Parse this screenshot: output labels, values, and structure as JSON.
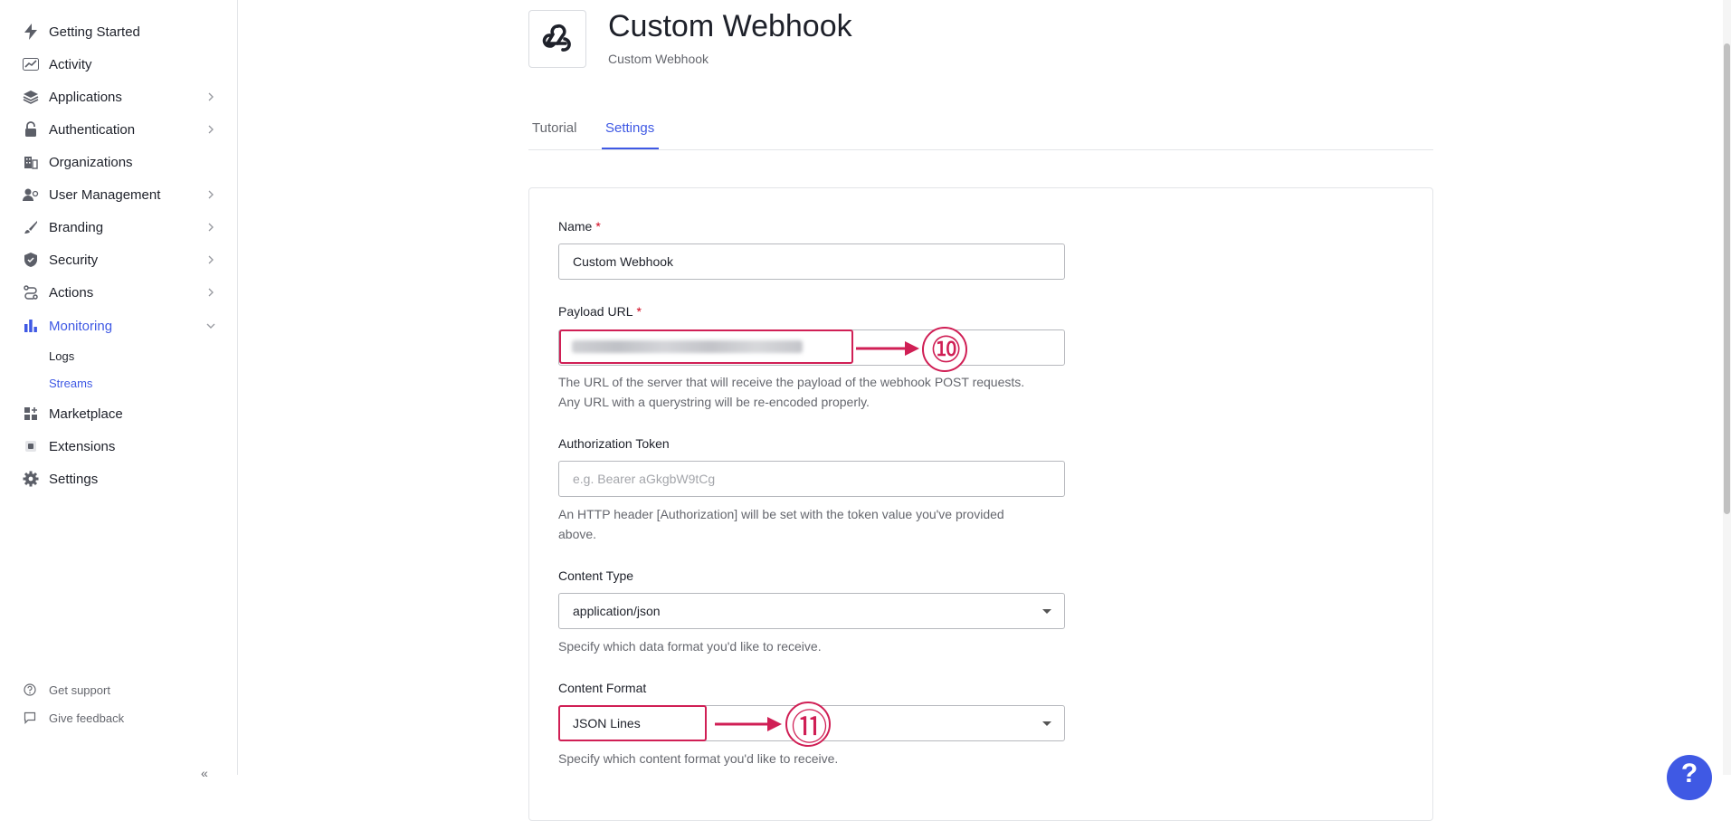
{
  "sidebar": {
    "items": [
      {
        "label": "Getting Started",
        "icon": "lightning-icon",
        "chevron": false
      },
      {
        "label": "Activity",
        "icon": "activity-chart-icon",
        "chevron": false
      },
      {
        "label": "Applications",
        "icon": "layers-icon",
        "chevron": true
      },
      {
        "label": "Authentication",
        "icon": "lock-icon",
        "chevron": true
      },
      {
        "label": "Organizations",
        "icon": "building-icon",
        "chevron": false
      },
      {
        "label": "User Management",
        "icon": "users-icon",
        "chevron": true
      },
      {
        "label": "Branding",
        "icon": "brush-icon",
        "chevron": true
      },
      {
        "label": "Security",
        "icon": "shield-icon",
        "chevron": true
      },
      {
        "label": "Actions",
        "icon": "flow-icon",
        "chevron": true
      },
      {
        "label": "Monitoring",
        "icon": "bar-chart-icon",
        "chevron": true,
        "expanded": true
      },
      {
        "label": "Marketplace",
        "icon": "grid-plus-icon",
        "chevron": false
      },
      {
        "label": "Extensions",
        "icon": "puzzle-icon",
        "chevron": false
      },
      {
        "label": "Settings",
        "icon": "gear-icon",
        "chevron": false
      }
    ],
    "monitoring_sub": [
      {
        "label": "Logs"
      },
      {
        "label": "Streams",
        "active": true
      }
    ],
    "footer": [
      {
        "label": "Get support",
        "icon": "help-circle-icon"
      },
      {
        "label": "Give feedback",
        "icon": "speech-bubble-icon"
      }
    ],
    "collapse_label": "«"
  },
  "header": {
    "title": "Custom Webhook",
    "subtitle": "Custom Webhook",
    "logo_icon": "webhook-icon"
  },
  "tabs": [
    {
      "label": "Tutorial",
      "active": false
    },
    {
      "label": "Settings",
      "active": true
    }
  ],
  "form": {
    "name": {
      "label": "Name",
      "required_mark": "*",
      "value": "Custom Webhook"
    },
    "payload_url": {
      "label": "Payload URL",
      "required_mark": "*",
      "help_line1": "The URL of the server that will receive the payload of the webhook POST requests.",
      "help_line2": "Any URL with a querystring will be re-encoded properly."
    },
    "auth_token": {
      "label": "Authorization Token",
      "placeholder": "e.g. Bearer aGkgbW9tCg",
      "help_line1": "An HTTP header [Authorization] will be set with the token value you've provided",
      "help_line2": "above."
    },
    "content_type": {
      "label": "Content Type",
      "value": "application/json",
      "help": "Specify which data format you'd like to receive."
    },
    "content_format": {
      "label": "Content Format",
      "value": "JSON Lines",
      "help": "Specify which content format you'd like to receive."
    }
  },
  "annotations": {
    "step_10": "⑩",
    "step_11": "⑪",
    "highlight_color": "#d01f55"
  },
  "colors": {
    "accent": "#3f59e4",
    "required": "#d0021b"
  },
  "help_button_label": "?"
}
